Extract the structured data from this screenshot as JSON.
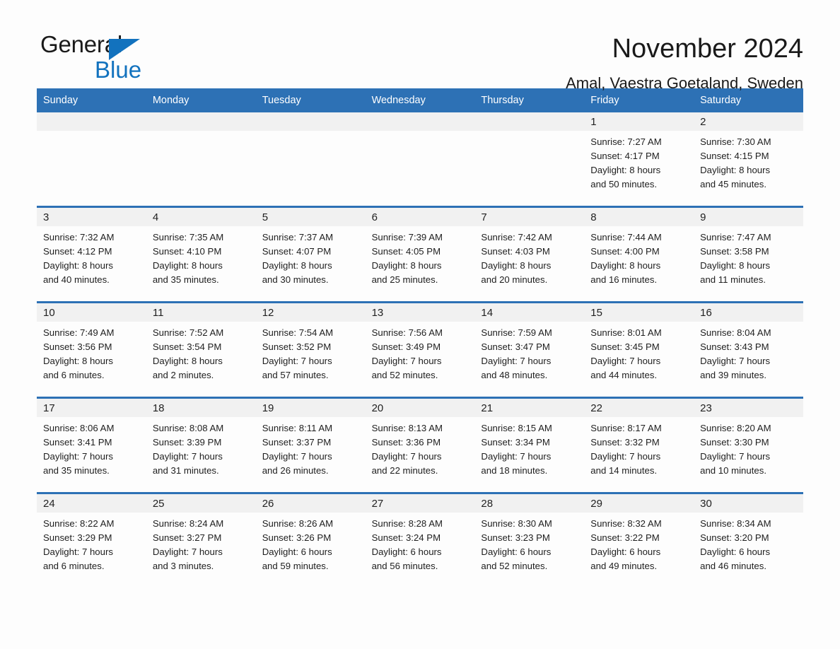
{
  "logo": {
    "word1": "General",
    "word2": "Blue",
    "triangle_color": "#1272be"
  },
  "header": {
    "title": "November 2024",
    "subtitle": "Amal, Vaestra Goetaland, Sweden"
  },
  "colors": {
    "header_blue": "#2d71b5",
    "band_gray": "#f1f1f1",
    "brand_blue": "#1272be"
  },
  "weekdays": [
    "Sunday",
    "Monday",
    "Tuesday",
    "Wednesday",
    "Thursday",
    "Friday",
    "Saturday"
  ],
  "weeks": [
    [
      {
        "day": "",
        "lines": []
      },
      {
        "day": "",
        "lines": []
      },
      {
        "day": "",
        "lines": []
      },
      {
        "day": "",
        "lines": []
      },
      {
        "day": "",
        "lines": []
      },
      {
        "day": "1",
        "lines": [
          "Sunrise: 7:27 AM",
          "Sunset: 4:17 PM",
          "Daylight: 8 hours",
          "and 50 minutes."
        ]
      },
      {
        "day": "2",
        "lines": [
          "Sunrise: 7:30 AM",
          "Sunset: 4:15 PM",
          "Daylight: 8 hours",
          "and 45 minutes."
        ]
      }
    ],
    [
      {
        "day": "3",
        "lines": [
          "Sunrise: 7:32 AM",
          "Sunset: 4:12 PM",
          "Daylight: 8 hours",
          "and 40 minutes."
        ]
      },
      {
        "day": "4",
        "lines": [
          "Sunrise: 7:35 AM",
          "Sunset: 4:10 PM",
          "Daylight: 8 hours",
          "and 35 minutes."
        ]
      },
      {
        "day": "5",
        "lines": [
          "Sunrise: 7:37 AM",
          "Sunset: 4:07 PM",
          "Daylight: 8 hours",
          "and 30 minutes."
        ]
      },
      {
        "day": "6",
        "lines": [
          "Sunrise: 7:39 AM",
          "Sunset: 4:05 PM",
          "Daylight: 8 hours",
          "and 25 minutes."
        ]
      },
      {
        "day": "7",
        "lines": [
          "Sunrise: 7:42 AM",
          "Sunset: 4:03 PM",
          "Daylight: 8 hours",
          "and 20 minutes."
        ]
      },
      {
        "day": "8",
        "lines": [
          "Sunrise: 7:44 AM",
          "Sunset: 4:00 PM",
          "Daylight: 8 hours",
          "and 16 minutes."
        ]
      },
      {
        "day": "9",
        "lines": [
          "Sunrise: 7:47 AM",
          "Sunset: 3:58 PM",
          "Daylight: 8 hours",
          "and 11 minutes."
        ]
      }
    ],
    [
      {
        "day": "10",
        "lines": [
          "Sunrise: 7:49 AM",
          "Sunset: 3:56 PM",
          "Daylight: 8 hours",
          "and 6 minutes."
        ]
      },
      {
        "day": "11",
        "lines": [
          "Sunrise: 7:52 AM",
          "Sunset: 3:54 PM",
          "Daylight: 8 hours",
          "and 2 minutes."
        ]
      },
      {
        "day": "12",
        "lines": [
          "Sunrise: 7:54 AM",
          "Sunset: 3:52 PM",
          "Daylight: 7 hours",
          "and 57 minutes."
        ]
      },
      {
        "day": "13",
        "lines": [
          "Sunrise: 7:56 AM",
          "Sunset: 3:49 PM",
          "Daylight: 7 hours",
          "and 52 minutes."
        ]
      },
      {
        "day": "14",
        "lines": [
          "Sunrise: 7:59 AM",
          "Sunset: 3:47 PM",
          "Daylight: 7 hours",
          "and 48 minutes."
        ]
      },
      {
        "day": "15",
        "lines": [
          "Sunrise: 8:01 AM",
          "Sunset: 3:45 PM",
          "Daylight: 7 hours",
          "and 44 minutes."
        ]
      },
      {
        "day": "16",
        "lines": [
          "Sunrise: 8:04 AM",
          "Sunset: 3:43 PM",
          "Daylight: 7 hours",
          "and 39 minutes."
        ]
      }
    ],
    [
      {
        "day": "17",
        "lines": [
          "Sunrise: 8:06 AM",
          "Sunset: 3:41 PM",
          "Daylight: 7 hours",
          "and 35 minutes."
        ]
      },
      {
        "day": "18",
        "lines": [
          "Sunrise: 8:08 AM",
          "Sunset: 3:39 PM",
          "Daylight: 7 hours",
          "and 31 minutes."
        ]
      },
      {
        "day": "19",
        "lines": [
          "Sunrise: 8:11 AM",
          "Sunset: 3:37 PM",
          "Daylight: 7 hours",
          "and 26 minutes."
        ]
      },
      {
        "day": "20",
        "lines": [
          "Sunrise: 8:13 AM",
          "Sunset: 3:36 PM",
          "Daylight: 7 hours",
          "and 22 minutes."
        ]
      },
      {
        "day": "21",
        "lines": [
          "Sunrise: 8:15 AM",
          "Sunset: 3:34 PM",
          "Daylight: 7 hours",
          "and 18 minutes."
        ]
      },
      {
        "day": "22",
        "lines": [
          "Sunrise: 8:17 AM",
          "Sunset: 3:32 PM",
          "Daylight: 7 hours",
          "and 14 minutes."
        ]
      },
      {
        "day": "23",
        "lines": [
          "Sunrise: 8:20 AM",
          "Sunset: 3:30 PM",
          "Daylight: 7 hours",
          "and 10 minutes."
        ]
      }
    ],
    [
      {
        "day": "24",
        "lines": [
          "Sunrise: 8:22 AM",
          "Sunset: 3:29 PM",
          "Daylight: 7 hours",
          "and 6 minutes."
        ]
      },
      {
        "day": "25",
        "lines": [
          "Sunrise: 8:24 AM",
          "Sunset: 3:27 PM",
          "Daylight: 7 hours",
          "and 3 minutes."
        ]
      },
      {
        "day": "26",
        "lines": [
          "Sunrise: 8:26 AM",
          "Sunset: 3:26 PM",
          "Daylight: 6 hours",
          "and 59 minutes."
        ]
      },
      {
        "day": "27",
        "lines": [
          "Sunrise: 8:28 AM",
          "Sunset: 3:24 PM",
          "Daylight: 6 hours",
          "and 56 minutes."
        ]
      },
      {
        "day": "28",
        "lines": [
          "Sunrise: 8:30 AM",
          "Sunset: 3:23 PM",
          "Daylight: 6 hours",
          "and 52 minutes."
        ]
      },
      {
        "day": "29",
        "lines": [
          "Sunrise: 8:32 AM",
          "Sunset: 3:22 PM",
          "Daylight: 6 hours",
          "and 49 minutes."
        ]
      },
      {
        "day": "30",
        "lines": [
          "Sunrise: 8:34 AM",
          "Sunset: 3:20 PM",
          "Daylight: 6 hours",
          "and 46 minutes."
        ]
      }
    ]
  ]
}
